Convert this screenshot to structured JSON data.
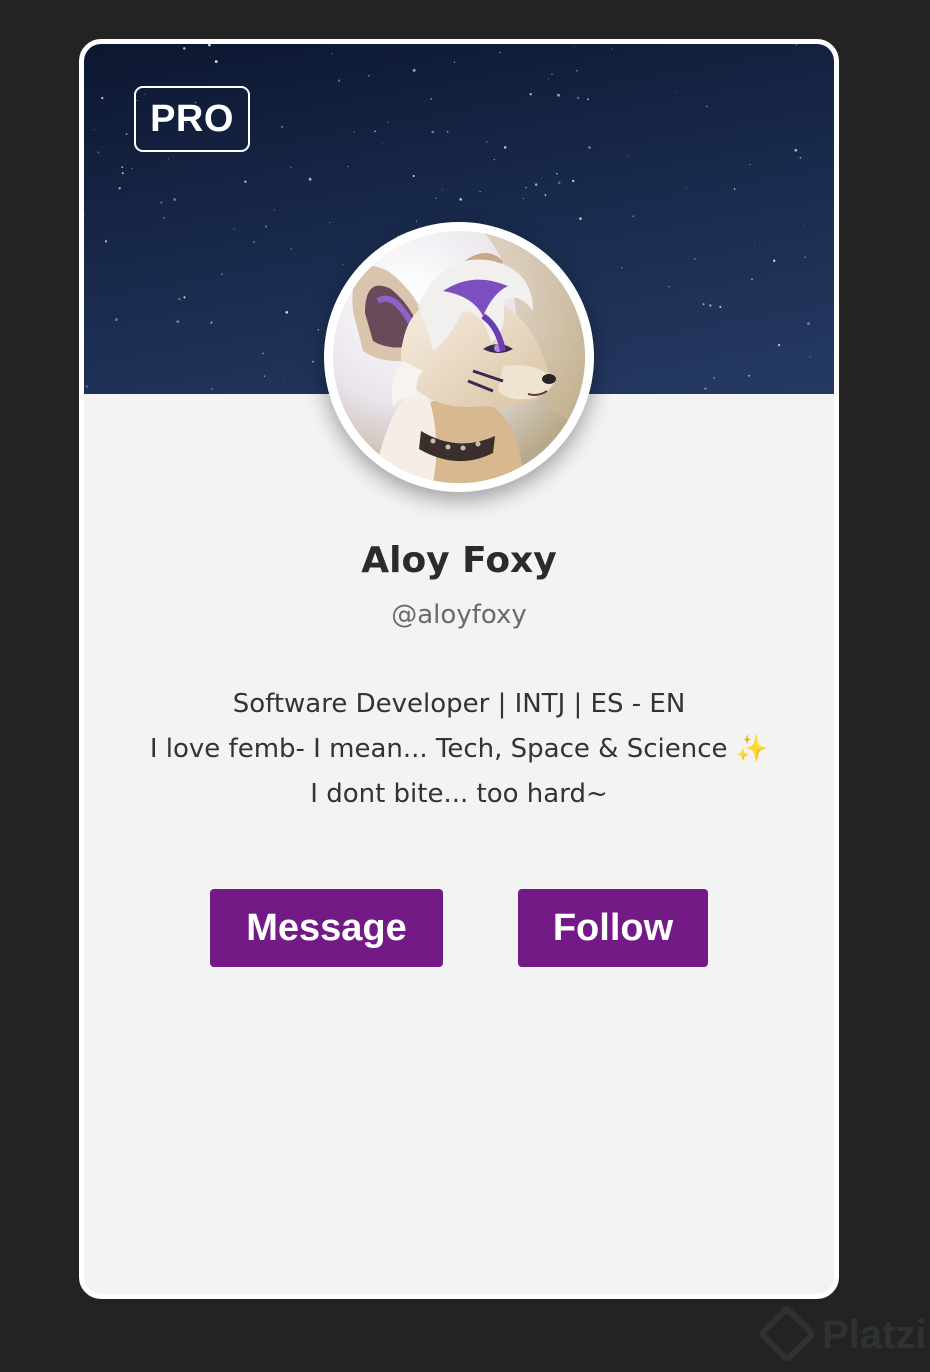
{
  "profile": {
    "badge": "PRO",
    "name": "Aloy Foxy",
    "handle": "@aloyfoxy",
    "bio": {
      "line1": "Software Developer | INTJ | ES - EN",
      "line2": "I love femb- I mean... Tech, Space & Science",
      "line2_emoji": "✨",
      "line3": "I dont bite... too hard~"
    }
  },
  "actions": {
    "message_label": "Message",
    "follow_label": "Follow"
  },
  "watermark": {
    "text": "Platzi",
    "icon": "platzi-logo-icon"
  },
  "colors": {
    "page_background": "#232323",
    "card_background": "#f3f3f4",
    "banner": "#18284a",
    "button": "#741a86",
    "name": "#2b2b2b",
    "handle": "#6a6a6a"
  },
  "icons": {
    "avatar": "fox-avatar-image",
    "banner": "starry-sky-banner",
    "sparkle": "sparkles-emoji"
  }
}
